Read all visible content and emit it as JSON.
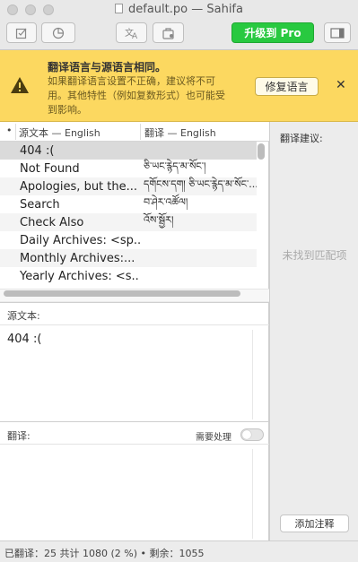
{
  "window": {
    "title": "default.po — Sahifa"
  },
  "toolbar": {
    "pro_label": "升级到 Pro"
  },
  "banner": {
    "title": "翻译语言与源语言相同。",
    "description": "如果翻译语言设置不正确，建议将不可用。其他特性（例如复数形式）也可能受到影响。",
    "fix_label": "修复语言",
    "close_label": "✕"
  },
  "table": {
    "header_dot": "•",
    "source_header": "源文本 — English",
    "translation_header": "翻译 — English",
    "rows": [
      {
        "source": "404 :(",
        "translation": ""
      },
      {
        "source": "Not Found",
        "translation": "ཅི་ཡང་རྙེད་མ་སོང་།"
      },
      {
        "source": "Apologies, but the...",
        "translation": "དགོངས་དག། ཅི་ཡང་རྙེད་མ་སོང་..."
      },
      {
        "source": "Search",
        "translation": "བ་ཤེར་འཚོལ།"
      },
      {
        "source": "Check Also",
        "translation": "འོས་སྦྱོར།"
      },
      {
        "source": "Daily Archives: <sp...",
        "translation": ""
      },
      {
        "source": "Monthly Archives:...",
        "translation": ""
      },
      {
        "source": "Yearly Archives: <s...",
        "translation": ""
      }
    ]
  },
  "source_panel": {
    "label": "源文本:",
    "text": "404 :("
  },
  "translation_panel": {
    "label": "翻译:",
    "fuzzy_label": "需要处理",
    "fuzzy_on": false
  },
  "sidebar": {
    "label": "翻译建议:",
    "empty_text": "未找到匹配项",
    "add_note_label": "添加注释"
  },
  "status": {
    "text": "已翻译：25 共计 1080 (2 %) • 剩余：1055"
  }
}
